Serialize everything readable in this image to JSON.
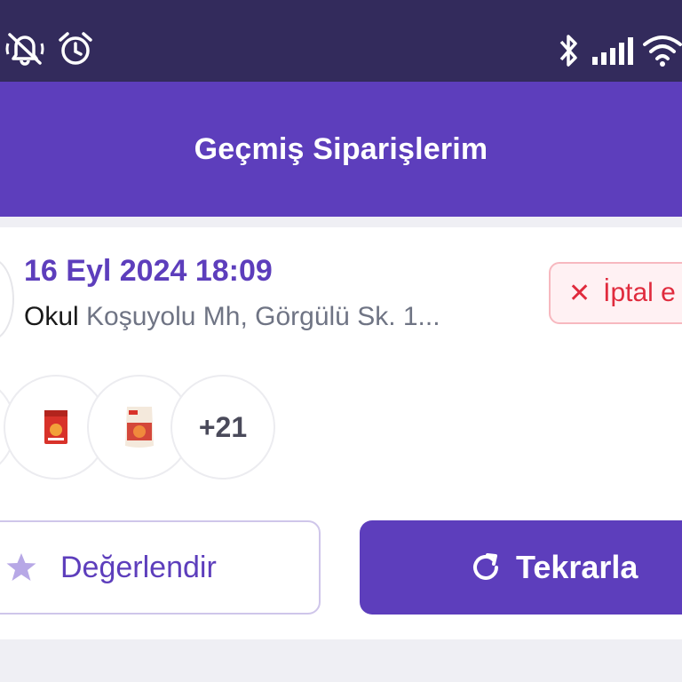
{
  "status_bar": {
    "icons": [
      "mute-icon",
      "alarm-icon",
      "bluetooth-icon",
      "signal-icon",
      "wifi-icon"
    ]
  },
  "header": {
    "title": "Geçmiş Siparişlerim"
  },
  "order": {
    "date": "16 Eyl 2024 18:09",
    "address_name": "Okul",
    "address_detail": "Koşuyolu Mh, Görgülü Sk. 1...",
    "status": "İptal e",
    "status_icon": "close-icon",
    "products": [
      "product-tomato-paste",
      "product-soup-package"
    ],
    "more_count": "+21",
    "actions": {
      "rate_label": "Değerlendir",
      "reorder_label": "Tekrarla"
    }
  },
  "colors": {
    "brand": "#5d3ebc",
    "status_bar": "#332b5c",
    "cancel_red": "#e02b3d"
  }
}
